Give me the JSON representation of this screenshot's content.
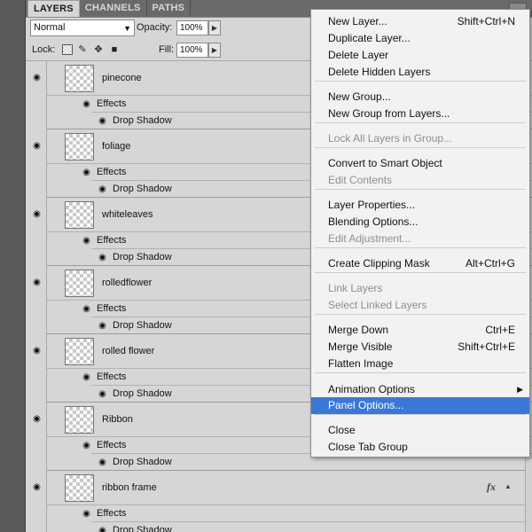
{
  "tabs": [
    "LAYERS",
    "CHANNELS",
    "PATHS"
  ],
  "blend_mode": "Normal",
  "opacity_label": "Opacity:",
  "opacity_value": "100%",
  "lock_label": "Lock:",
  "fill_label": "Fill:",
  "fill_value": "100%",
  "effects_label": "Effects",
  "drop_shadow_label": "Drop Shadow",
  "layers": [
    {
      "name": "pinecone"
    },
    {
      "name": "foliage"
    },
    {
      "name": "whiteleaves"
    },
    {
      "name": "rolledflower"
    },
    {
      "name": "rolled flower"
    },
    {
      "name": "Ribbon"
    },
    {
      "name": "ribbon frame"
    }
  ],
  "fx_label": "fx",
  "menu": {
    "items": [
      {
        "label": "New Layer...",
        "shortcut": "Shift+Ctrl+N"
      },
      {
        "label": "Duplicate Layer..."
      },
      {
        "label": "Delete Layer"
      },
      {
        "label": "Delete Hidden Layers"
      },
      {
        "label": "New Group..."
      },
      {
        "label": "New Group from Layers..."
      },
      {
        "label": "Lock All Layers in Group...",
        "disabled": true
      },
      {
        "label": "Convert to Smart Object"
      },
      {
        "label": "Edit Contents",
        "disabled": true
      },
      {
        "label": "Layer Properties..."
      },
      {
        "label": "Blending Options..."
      },
      {
        "label": "Edit Adjustment...",
        "disabled": true
      },
      {
        "label": "Create Clipping Mask",
        "shortcut": "Alt+Ctrl+G"
      },
      {
        "label": "Link Layers",
        "disabled": true
      },
      {
        "label": "Select Linked Layers",
        "disabled": true
      },
      {
        "label": "Merge Down",
        "shortcut": "Ctrl+E"
      },
      {
        "label": "Merge Visible",
        "shortcut": "Shift+Ctrl+E"
      },
      {
        "label": "Flatten Image"
      },
      {
        "label": "Animation Options",
        "submenu": true
      },
      {
        "label": "Panel Options...",
        "selected": true
      },
      {
        "label": "Close"
      },
      {
        "label": "Close Tab Group"
      }
    ]
  },
  "colors": {
    "menu_highlight": "#3a78d8",
    "panel_bg": "#d6d6d6"
  }
}
